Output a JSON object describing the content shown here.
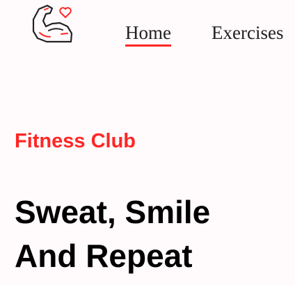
{
  "brand": {
    "logo_icon": "flexed-arm-heart-icon",
    "accent_color": "#ff2625"
  },
  "nav": {
    "home_label": "Home",
    "exercises_label": "Exercises"
  },
  "hero": {
    "eyebrow": "Fitness Club",
    "title_line1": "Sweat, Smile",
    "title_line2": "And Repeat"
  }
}
